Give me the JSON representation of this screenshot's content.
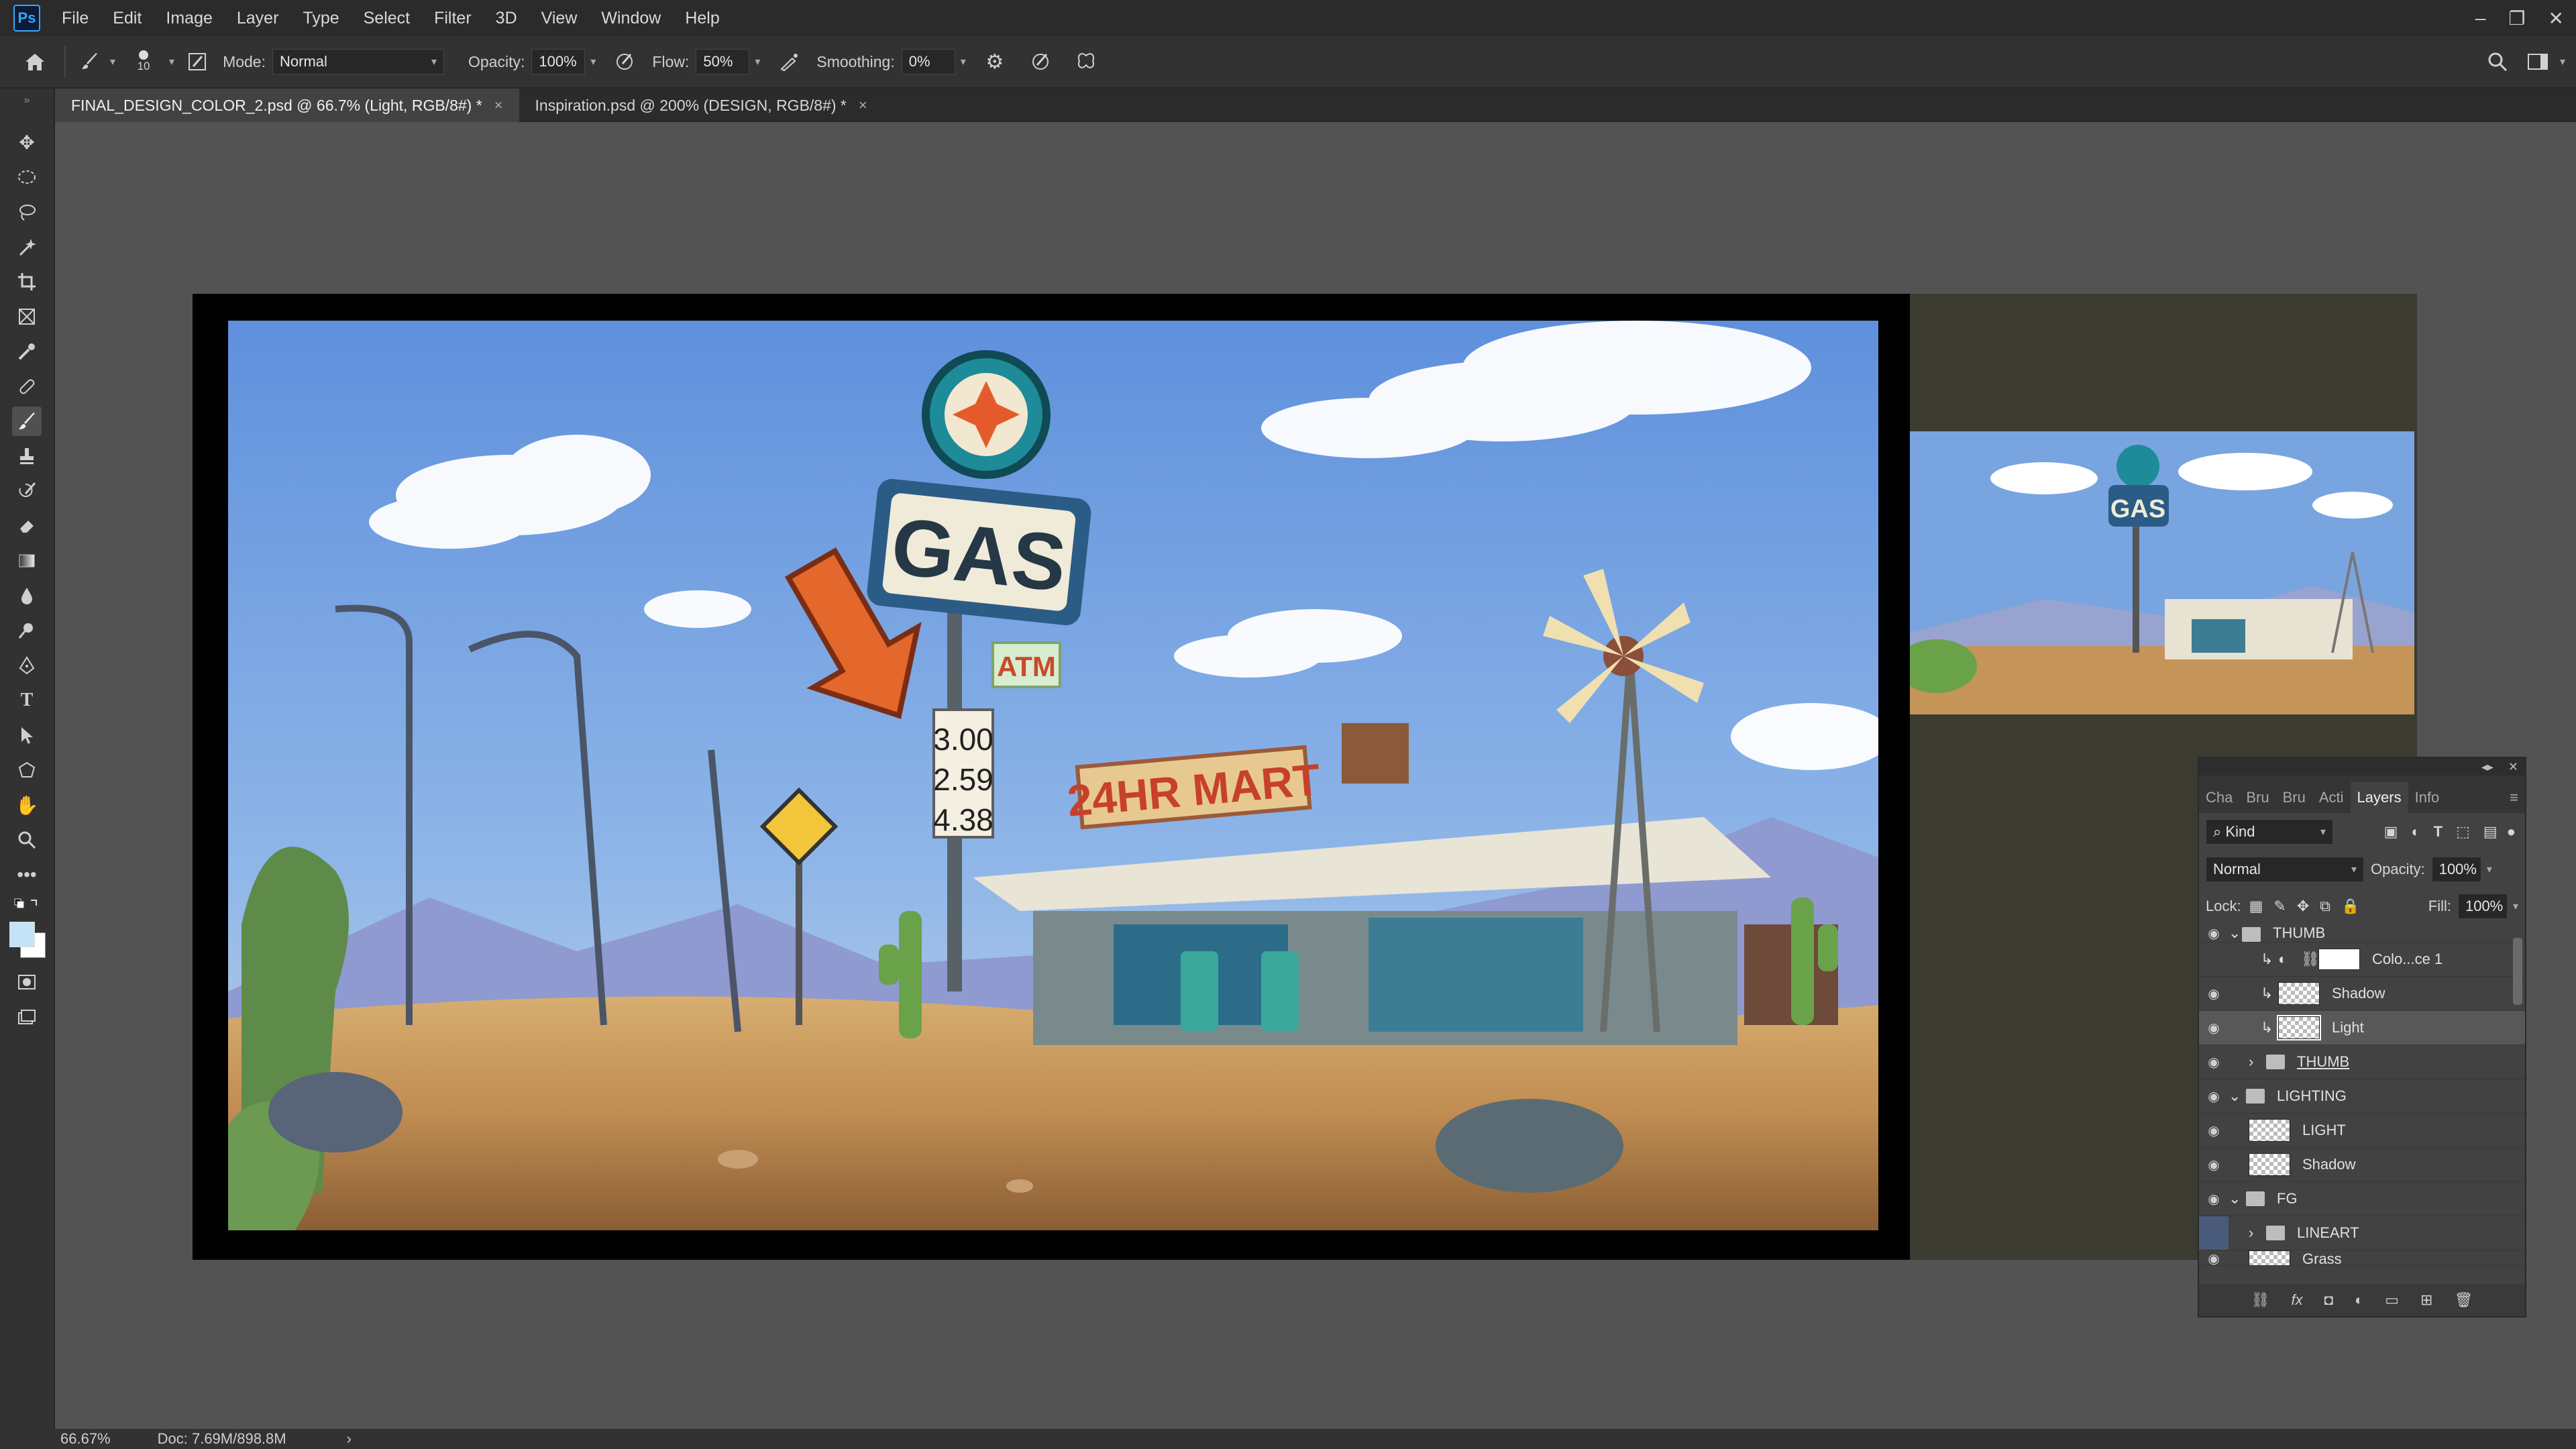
{
  "app": {
    "logo": "Ps"
  },
  "menu": [
    "File",
    "Edit",
    "Image",
    "Layer",
    "Type",
    "Select",
    "Filter",
    "3D",
    "View",
    "Window",
    "Help"
  ],
  "options": {
    "brush_size": "10",
    "mode_label": "Mode:",
    "mode_value": "Normal",
    "opacity_label": "Opacity:",
    "opacity_value": "100%",
    "flow_label": "Flow:",
    "flow_value": "50%",
    "smoothing_label": "Smoothing:",
    "smoothing_value": "0%"
  },
  "tabs": [
    {
      "label": "FINAL_DESIGN_COLOR_2.psd @ 66.7% (Light, RGB/8#) *",
      "close": "×"
    },
    {
      "label": "Inspiration.psd @ 200% (DESIGN, RGB/8#) *",
      "close": "×"
    }
  ],
  "artwork": {
    "sign_gas": "GAS",
    "sign_atm": "ATM",
    "prices": [
      "3.00",
      "2.59",
      "4.38"
    ],
    "store_sign": "24HR MART",
    "thumb_sign": "GAS"
  },
  "status": {
    "zoom": "66.67%",
    "doc": "Doc: 7.69M/898.8M",
    "arrow": "›"
  },
  "layers_panel": {
    "tabs": [
      "Cha",
      "Bru",
      "Bru",
      "Acti",
      "Layers",
      "Info"
    ],
    "kind_label": "Kind",
    "blend_mode": "Normal",
    "opacity_label": "Opacity:",
    "opacity_value": "100%",
    "lock_label": "Lock:",
    "fill_label": "Fill:",
    "fill_value": "100%",
    "rows": [
      {
        "name": "THUMB"
      },
      {
        "name": "Colo...ce 1"
      },
      {
        "name": "Shadow"
      },
      {
        "name": "Light"
      },
      {
        "name": "THUMB"
      },
      {
        "name": "LIGHTING"
      },
      {
        "name": "LIGHT"
      },
      {
        "name": "Shadow"
      },
      {
        "name": "FG"
      },
      {
        "name": "LINEART"
      },
      {
        "name": "Grass"
      }
    ]
  },
  "colors": {
    "accent": "#31a8ff",
    "sky": "#6e9ede",
    "ground": "#c99a5e"
  }
}
